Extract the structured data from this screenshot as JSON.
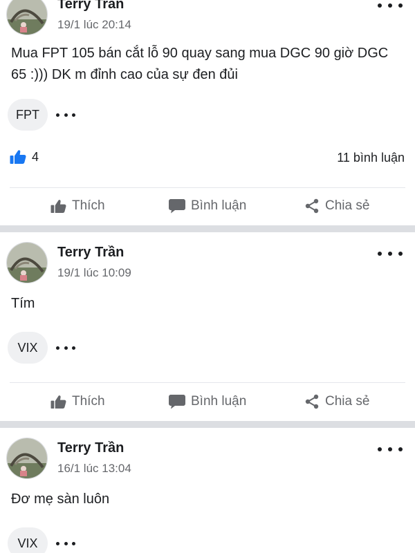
{
  "colors": {
    "accent": "#1877f2",
    "text_primary": "#1c1e21",
    "text_secondary": "#65676b",
    "chip_background": "#eff0f2",
    "separator": "#dcdee2"
  },
  "icons": {
    "like": "thumbs-up-icon",
    "comment": "speech-bubble-icon",
    "share": "share-icon",
    "more": "more-options-icon"
  },
  "actions": {
    "like_label": "Thích",
    "comment_label": "Bình luận",
    "share_label": "Chia sẻ"
  },
  "posts": [
    {
      "author": "Terry Trần",
      "timestamp": "19/1 lúc 20:14",
      "text": "Mua FPT 105 bán cắt lỗ 90 quay sang mua DGC 90 giờ DGC 65 :))) DK m đỉnh cao của sự đen đủi",
      "tag": "FPT",
      "like_count": "4",
      "comment_count": "11 bình luận"
    },
    {
      "author": "Terry Trần",
      "timestamp": "19/1 lúc 10:09",
      "text": "Tím",
      "tag": "VIX"
    },
    {
      "author": "Terry Trần",
      "timestamp": "16/1 lúc 13:04",
      "text": "Đơ mẹ sàn luôn",
      "tag": "VIX"
    }
  ]
}
